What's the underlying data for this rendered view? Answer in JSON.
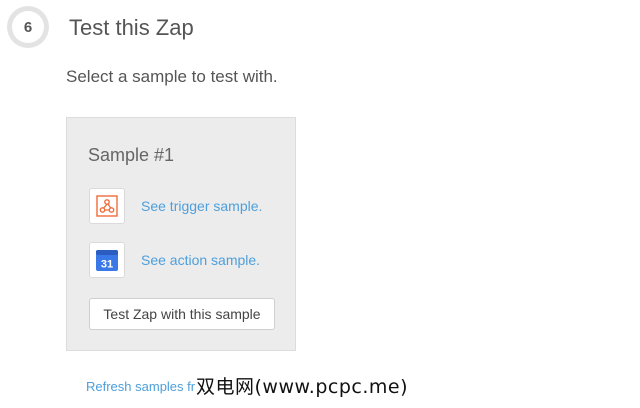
{
  "step": {
    "number": "6",
    "title": "Test this Zap"
  },
  "instructions": "Select a sample to test with.",
  "sample": {
    "title": "Sample #1",
    "trigger": {
      "icon": "webhook-icon",
      "icon_color": "#f26b3a",
      "link_label": "See trigger sample."
    },
    "action": {
      "icon": "google-calendar-icon",
      "icon_color": "#3b78e7",
      "icon_text": "31",
      "link_label": "See action sample."
    },
    "test_button_label": "Test Zap with this sample"
  },
  "refresh_link_label": "Refresh samples fr",
  "watermark": "双电网(www.pcpc.me)",
  "colors": {
    "link": "#4d9fdc",
    "card_background": "#ececec"
  }
}
